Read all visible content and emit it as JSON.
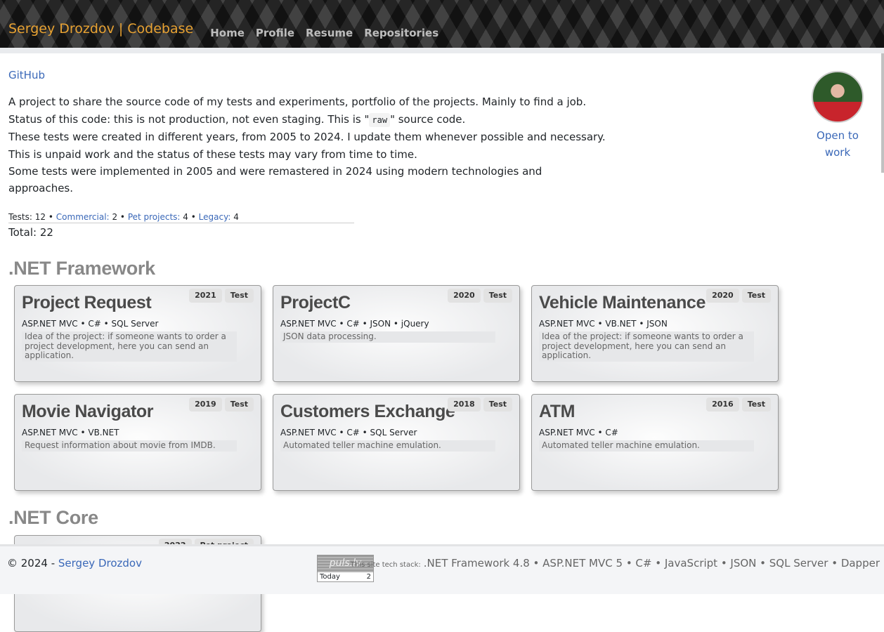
{
  "header": {
    "brand": "Sergey Drozdov | Codebase",
    "nav": [
      "Home",
      "Profile",
      "Resume",
      "Repositories"
    ]
  },
  "github_link": "GitHub",
  "intro": {
    "line1": "A project to share the source code of my tests and experiments, portfolio of the projects. Mainly to find a job.",
    "line2_pre": "Status of this code: this is not production, not even staging. This is \"",
    "line2_code": "raw",
    "line2_post": "\" source code.",
    "line3": "These tests were created in different years, from 2005 to 2024. I update them whenever possible and necessary. This is unpaid work and the status of these tests may vary from time to time.",
    "line4": "Some tests were implemented in 2005 and were remastered in 2024 using modern technologies and approaches."
  },
  "profile": {
    "open_to_work": "Open to work"
  },
  "counts": {
    "tests_label": "Tests:",
    "tests": "12",
    "commercial_label": "Commercial:",
    "commercial": "2",
    "pet_label": "Pet projects:",
    "pet": "4",
    "legacy_label": "Legacy:",
    "legacy": "4",
    "sep": "•",
    "total": "Total: 22"
  },
  "sections": [
    {
      "title": ".NET Framework",
      "cards": [
        {
          "title": "Project Request",
          "year": "2021",
          "type": "Test",
          "stack": "ASP.NET MVC • C# • SQL Server",
          "desc": "Idea of the project: if someone wants to order a project development, here you can send an application."
        },
        {
          "title": "ProjectC",
          "year": "2020",
          "type": "Test",
          "stack": "ASP.NET MVC • C# • JSON • jQuery",
          "desc": "JSON data processing."
        },
        {
          "title": "Vehicle Maintenance",
          "year": "2020",
          "type": "Test",
          "stack": "ASP.NET MVC • VB.NET • JSON",
          "desc": "Idea of the project: if someone wants to order a project development, here you can send an application."
        },
        {
          "title": "Movie Navigator",
          "year": "2019",
          "type": "Test",
          "stack": "ASP.NET MVC • VB.NET",
          "desc": "Request information about movie from IMDB."
        },
        {
          "title": "Customers Exchange",
          "year": "2018",
          "type": "Test",
          "stack": "ASP.NET MVC • C# • SQL Server",
          "desc": "Automated teller machine emulation."
        },
        {
          "title": "ATM",
          "year": "2016",
          "type": "Test",
          "stack": "ASP.NET MVC • C#",
          "desc": "Automated teller machine emulation."
        }
      ]
    },
    {
      "title": ".NET Core",
      "cards": [
        {
          "title": "",
          "year": "2022",
          "type": "Pet project",
          "stack": "",
          "desc": ""
        }
      ]
    }
  ],
  "footer": {
    "copyright": "© 2024 - ",
    "author": "Sergey Drozdov",
    "counter_logo": "puls.lv",
    "counter_today": "Today",
    "counter_value": "2",
    "tech_label": "This site tech stack:",
    "tech": ".NET Framework 4.8 • ASP.NET MVC 5 • C# • JavaScript • JSON • SQL Server • Dapper"
  }
}
